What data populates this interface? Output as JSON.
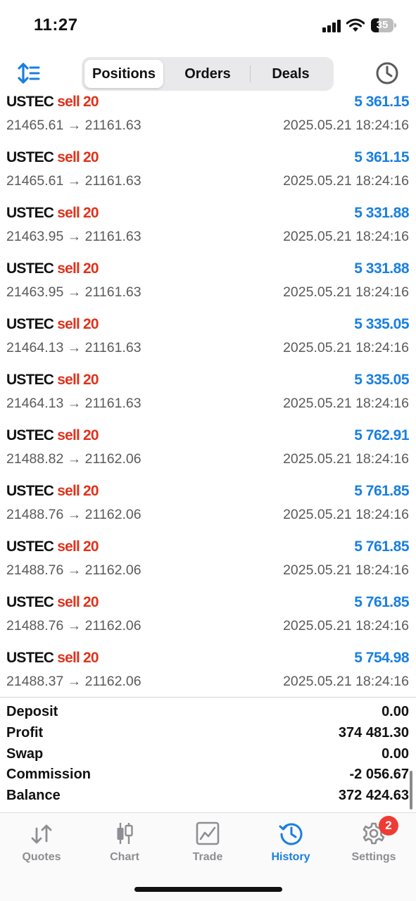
{
  "status_bar": {
    "time": "11:27",
    "battery_level": "35"
  },
  "toolbar": {
    "sort_icon": "sort-icon",
    "history_clock_icon": "clock-icon",
    "segments": [
      {
        "label": "Positions",
        "active": true
      },
      {
        "label": "Orders",
        "active": false
      },
      {
        "label": "Deals",
        "active": false
      }
    ]
  },
  "deals": [
    {
      "symbol": "USTEC",
      "side": "sell 20",
      "profit": "5 361.15",
      "prices": "21465.61 → 21161.63",
      "time": "2025.05.21 18:24:16"
    },
    {
      "symbol": "USTEC",
      "side": "sell 20",
      "profit": "5 361.15",
      "prices": "21465.61 → 21161.63",
      "time": "2025.05.21 18:24:16"
    },
    {
      "symbol": "USTEC",
      "side": "sell 20",
      "profit": "5 331.88",
      "prices": "21463.95 → 21161.63",
      "time": "2025.05.21 18:24:16"
    },
    {
      "symbol": "USTEC",
      "side": "sell 20",
      "profit": "5 331.88",
      "prices": "21463.95 → 21161.63",
      "time": "2025.05.21 18:24:16"
    },
    {
      "symbol": "USTEC",
      "side": "sell 20",
      "profit": "5 335.05",
      "prices": "21464.13 → 21161.63",
      "time": "2025.05.21 18:24:16"
    },
    {
      "symbol": "USTEC",
      "side": "sell 20",
      "profit": "5 335.05",
      "prices": "21464.13 → 21161.63",
      "time": "2025.05.21 18:24:16"
    },
    {
      "symbol": "USTEC",
      "side": "sell 20",
      "profit": "5 762.91",
      "prices": "21488.82 → 21162.06",
      "time": "2025.05.21 18:24:16"
    },
    {
      "symbol": "USTEC",
      "side": "sell 20",
      "profit": "5 761.85",
      "prices": "21488.76 → 21162.06",
      "time": "2025.05.21 18:24:16"
    },
    {
      "symbol": "USTEC",
      "side": "sell 20",
      "profit": "5 761.85",
      "prices": "21488.76 → 21162.06",
      "time": "2025.05.21 18:24:16"
    },
    {
      "symbol": "USTEC",
      "side": "sell 20",
      "profit": "5 761.85",
      "prices": "21488.76 → 21162.06",
      "time": "2025.05.21 18:24:16"
    },
    {
      "symbol": "USTEC",
      "side": "sell 20",
      "profit": "5 754.98",
      "prices": "21488.37 → 21162.06",
      "time": "2025.05.21 18:24:16"
    }
  ],
  "summary": [
    {
      "label": "Deposit",
      "value": "0.00"
    },
    {
      "label": "Profit",
      "value": "374 481.30"
    },
    {
      "label": "Swap",
      "value": "0.00"
    },
    {
      "label": "Commission",
      "value": "-2 056.67"
    },
    {
      "label": "Balance",
      "value": "372 424.63"
    }
  ],
  "tabs": [
    {
      "label": "Quotes",
      "icon": "quotes-arrows-icon",
      "active": false
    },
    {
      "label": "Chart",
      "icon": "candlestick-icon",
      "active": false
    },
    {
      "label": "Trade",
      "icon": "trade-chart-icon",
      "active": false
    },
    {
      "label": "History",
      "icon": "history-clock-icon",
      "active": true
    },
    {
      "label": "Settings",
      "icon": "gear-icon",
      "active": false,
      "badge": "2"
    }
  ],
  "colors": {
    "accent_blue": "#1a7fe0",
    "sell_red": "#e0321c",
    "badge_red": "#ee3c34"
  }
}
